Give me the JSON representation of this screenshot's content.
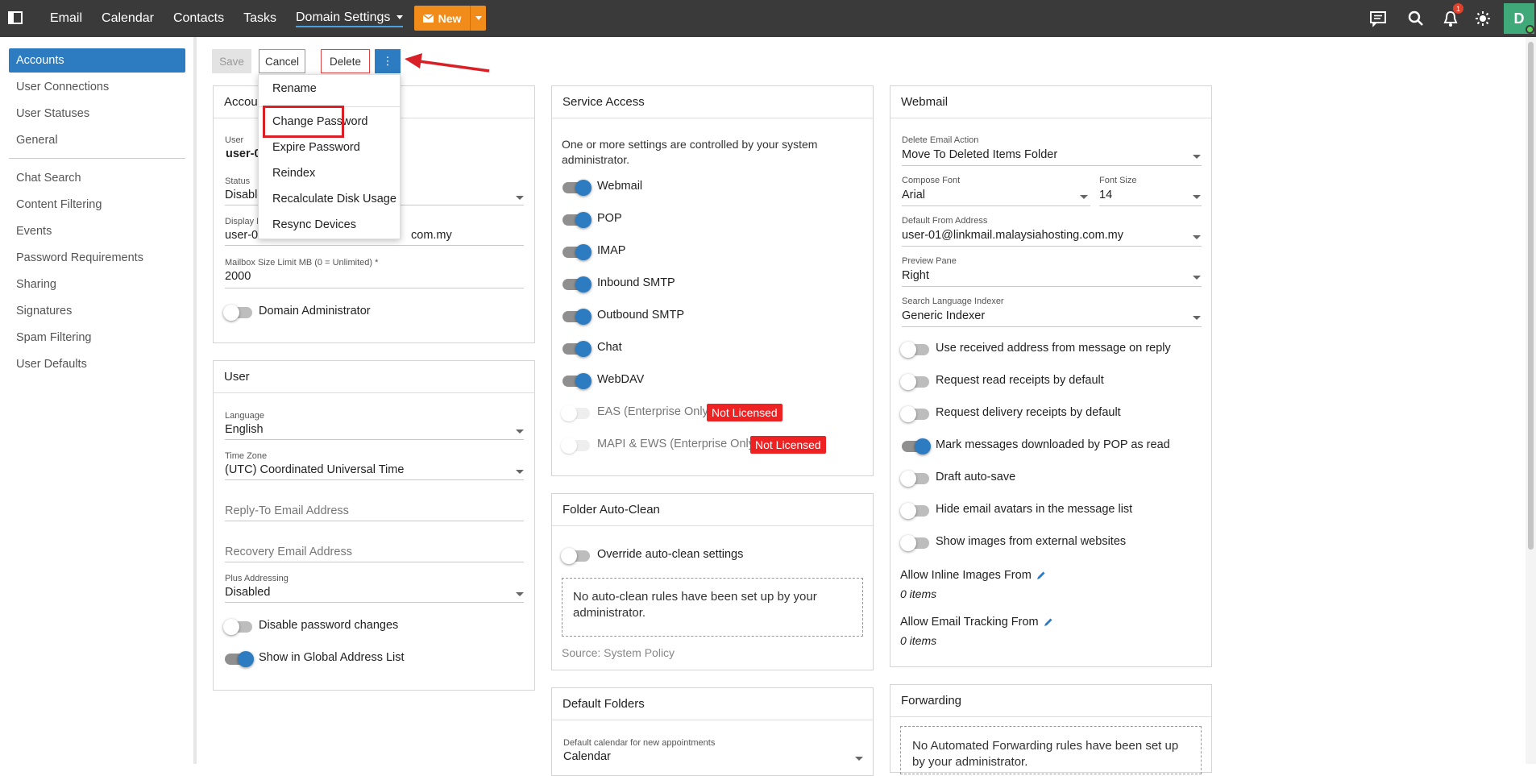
{
  "topbar": {
    "nav": [
      "Email",
      "Calendar",
      "Contacts",
      "Tasks",
      "Domain Settings"
    ],
    "new_label": "New",
    "notification_count": "1",
    "avatar_letter": "D"
  },
  "sidebar": {
    "group1": [
      "Accounts",
      "User Connections",
      "User Statuses",
      "General"
    ],
    "group2": [
      "Chat Search",
      "Content Filtering",
      "Events",
      "Password Requirements",
      "Sharing",
      "Signatures",
      "Spam Filtering",
      "User Defaults"
    ]
  },
  "toolbar": {
    "save": "Save",
    "cancel": "Cancel",
    "delete": "Delete",
    "more": "⋮"
  },
  "menu": {
    "items": [
      "Rename",
      "Change Password",
      "Expire Password",
      "Reindex",
      "Recalculate Disk Usage",
      "Resync Devices"
    ]
  },
  "account": {
    "title": "Accou",
    "user_label": "User",
    "user_value": "user-0",
    "status_label": "Status",
    "status_value": "Disable",
    "display_label": "Display N",
    "display_value_start": "user-0",
    "display_value_end": "com.my",
    "mailbox_label": "Mailbox Size Limit MB (0 = Unlimited) *",
    "mailbox_value": "2000",
    "domain_admin": "Domain Administrator"
  },
  "user": {
    "title": "User",
    "language_label": "Language",
    "language_value": "English",
    "tz_label": "Time Zone",
    "tz_value": "(UTC) Coordinated Universal Time",
    "replyto_placeholder": "Reply-To Email Address",
    "recovery_placeholder": "Recovery Email Address",
    "plus_label": "Plus Addressing",
    "plus_value": "Disabled",
    "disable_pw": "Disable password changes",
    "show_gal": "Show in Global Address List"
  },
  "service": {
    "title": "Service Access",
    "note": "One or more settings are controlled by your system administrator.",
    "toggles": [
      "Webmail",
      "POP",
      "IMAP",
      "Inbound SMTP",
      "Outbound SMTP",
      "Chat",
      "WebDAV"
    ],
    "eas": "EAS (Enterprise Only)",
    "mapi": "MAPI & EWS (Enterprise Only)",
    "not_licensed": "Not Licensed"
  },
  "autoclean": {
    "title": "Folder Auto-Clean",
    "override": "Override auto-clean settings",
    "empty": "No auto-clean rules have been set up by your administrator.",
    "source": "Source: System Policy"
  },
  "folders": {
    "title": "Default Folders",
    "calendar_label": "Default calendar for new appointments",
    "calendar_value": "Calendar"
  },
  "webmail": {
    "title": "Webmail",
    "delete_label": "Delete Email Action",
    "delete_value": "Move To Deleted Items Folder",
    "font_label": "Compose Font",
    "font_value": "Arial",
    "size_label": "Font Size",
    "size_value": "14",
    "from_label": "Default From Address",
    "from_value": "user-01@linkmail.malaysiahosting.com.my",
    "preview_label": "Preview Pane",
    "preview_value": "Right",
    "indexer_label": "Search Language Indexer",
    "indexer_value": "Generic Indexer",
    "toggles": [
      "Use received address from message on reply",
      "Request read receipts by default",
      "Request delivery receipts by default",
      "Mark messages downloaded by POP as read",
      "Draft auto-save",
      "Hide email avatars in the message list",
      "Show images from external websites"
    ],
    "inline_label": "Allow Inline Images From",
    "inline_value": "0 items",
    "tracking_label": "Allow Email Tracking From",
    "tracking_value": "0 items"
  },
  "forwarding": {
    "title": "Forwarding",
    "empty": "No Automated Forwarding rules have been set up by your administrator."
  },
  "colors": {
    "accent": "#2d7cc1",
    "new_button": "#f18b1a",
    "annotation": "#d92027",
    "not_licensed": "#ee2222"
  }
}
